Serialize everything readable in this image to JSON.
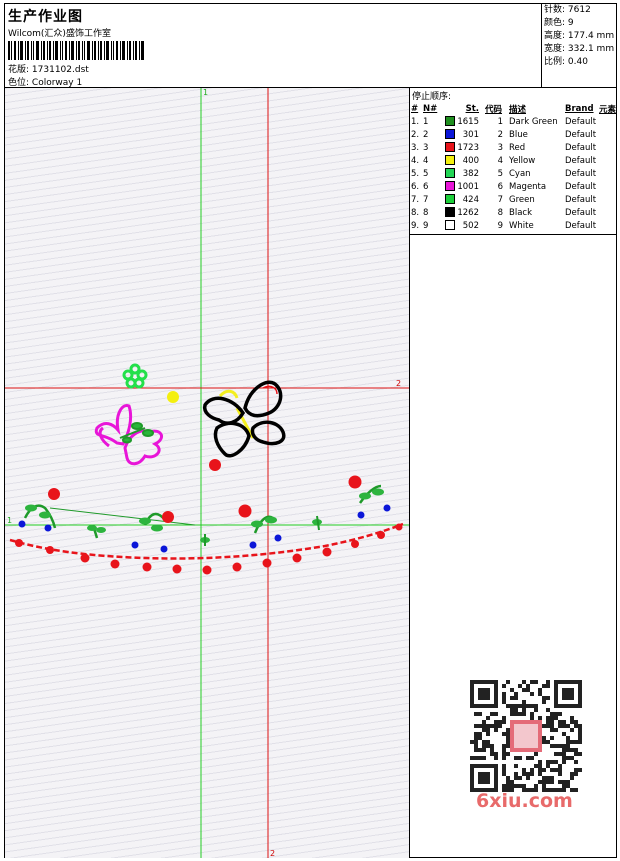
{
  "header": {
    "title": "生产作业图",
    "studio": "Wilcom(汇众)盛饰工作室",
    "design_label": "花版:",
    "design_file": "1731102.dst",
    "colorway_label": "色位:",
    "colorway": "Colorway 1"
  },
  "stats": [
    {
      "label": "针数:",
      "value": "7612"
    },
    {
      "label": "颜色:",
      "value": "9"
    },
    {
      "label": "高度:",
      "value": "177.4 mm"
    },
    {
      "label": "宽度:",
      "value": "332.1 mm"
    },
    {
      "label": "比例:",
      "value": "0.40"
    }
  ],
  "stop_sequence": {
    "title": "停止顺序:",
    "columns": [
      "#",
      "N#",
      "St.",
      "代码",
      "描述",
      "Brand",
      "元素"
    ],
    "rows": [
      {
        "num": "1.",
        "n": "1",
        "st": "1615",
        "code": "1",
        "desc": "Dark Green",
        "brand": "Default",
        "color": "#1f8f1f"
      },
      {
        "num": "2.",
        "n": "2",
        "st": "301",
        "code": "2",
        "desc": "Blue",
        "brand": "Default",
        "color": "#0b16d8"
      },
      {
        "num": "3.",
        "n": "3",
        "st": "1723",
        "code": "3",
        "desc": "Red",
        "brand": "Default",
        "color": "#e8141b"
      },
      {
        "num": "4.",
        "n": "4",
        "st": "400",
        "code": "4",
        "desc": "Yellow",
        "brand": "Default",
        "color": "#f4f010"
      },
      {
        "num": "5.",
        "n": "5",
        "st": "382",
        "code": "5",
        "desc": "Cyan",
        "brand": "Default",
        "color": "#23d656"
      },
      {
        "num": "6.",
        "n": "6",
        "st": "1001",
        "code": "6",
        "desc": "Magenta",
        "brand": "Default",
        "color": "#e815d8"
      },
      {
        "num": "7.",
        "n": "7",
        "st": "424",
        "code": "7",
        "desc": "Green",
        "brand": "Default",
        "color": "#1ccf3a"
      },
      {
        "num": "8.",
        "n": "8",
        "st": "1262",
        "code": "8",
        "desc": "Black",
        "brand": "Default",
        "color": "#000000"
      },
      {
        "num": "9.",
        "n": "9",
        "st": "502",
        "code": "9",
        "desc": "White",
        "brand": "Default",
        "color": "#ffffff"
      }
    ]
  },
  "guides": {
    "v1": "1",
    "v2": "2",
    "h1": "1",
    "h2": "2",
    "green": "#22cc22",
    "red": "#dd1111"
  },
  "watermark": "6xiu.com"
}
